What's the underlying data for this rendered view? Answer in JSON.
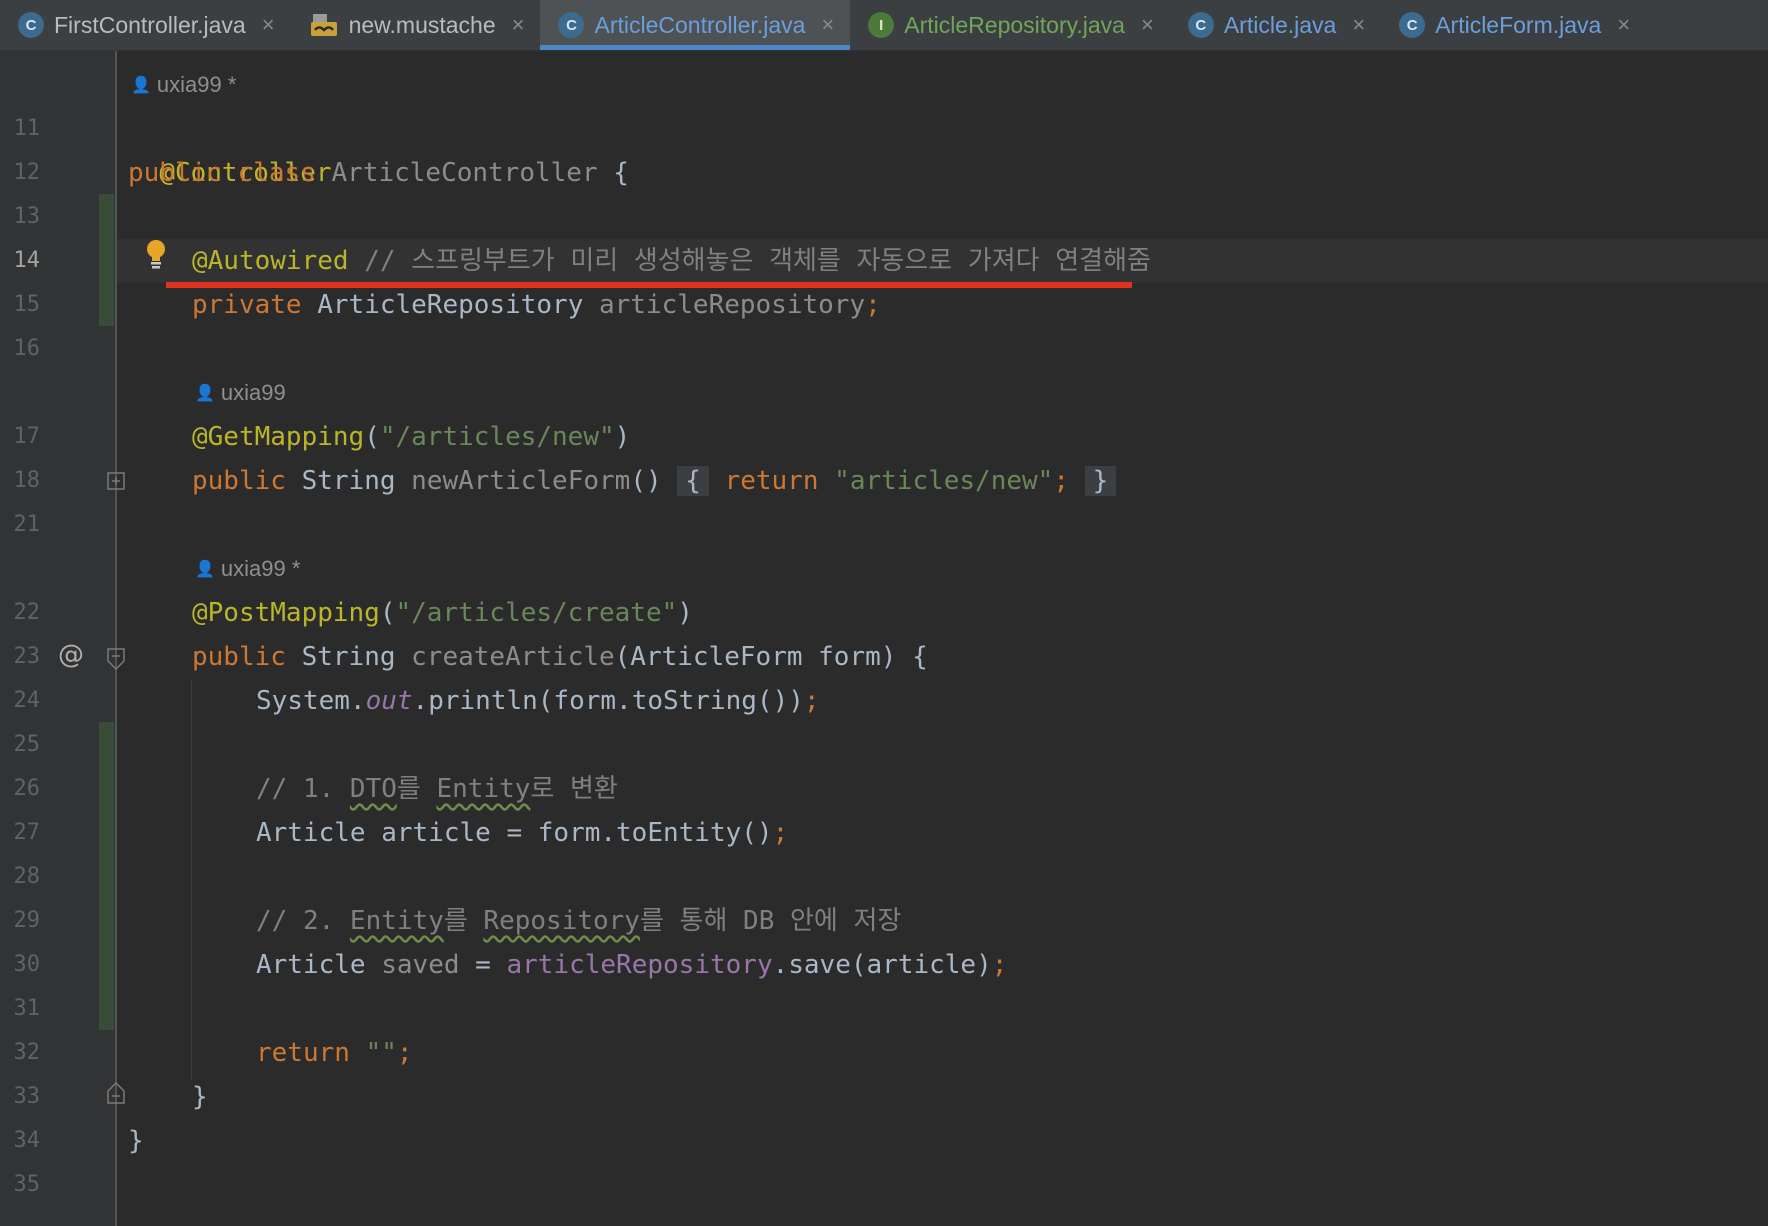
{
  "tabs": [
    {
      "label": "FirstController.java",
      "icon": "class-icon",
      "icon_glyph": "C",
      "state": "normal"
    },
    {
      "label": "new.mustache",
      "icon": "mustache-icon",
      "icon_glyph": "",
      "state": "normal"
    },
    {
      "label": "ArticleController.java",
      "icon": "class-icon",
      "icon_glyph": "C",
      "state": "active"
    },
    {
      "label": "ArticleRepository.java",
      "icon": "interface-icon",
      "icon_glyph": "I",
      "state": "green"
    },
    {
      "label": "Article.java",
      "icon": "class-icon",
      "icon_glyph": "C",
      "state": "blue"
    },
    {
      "label": "ArticleForm.java",
      "icon": "class-icon",
      "icon_glyph": "C",
      "state": "blue"
    }
  ],
  "close_glyph": "×",
  "authors": {
    "a1": "uxia99 *",
    "a2": "uxia99",
    "a3": "uxia99 *"
  },
  "line_numbers": [
    "11",
    "12",
    "13",
    "14",
    "15",
    "16",
    "17",
    "18",
    "21",
    "22",
    "23",
    "24",
    "25",
    "26",
    "27",
    "28",
    "29",
    "30",
    "31",
    "32",
    "33",
    "34",
    "35"
  ],
  "gutter_at": "@",
  "code": {
    "l11_ann": "@Controller",
    "l12_kw": "public class ",
    "l12_name": "ArticleController ",
    "l12_brace": "{",
    "l14_ann": "@Autowired",
    "l14_cmt": " // 스프링부트가 미리 생성해놓은 객체를 자동으로 가져다 연결해줌",
    "l15_kw": "private ",
    "l15_type": "ArticleRepository ",
    "l15_name": "articleRepository",
    "l15_semi": ";",
    "l17_ann": "@GetMapping",
    "l17_p1": "(",
    "l17_str": "\"/articles/new\"",
    "l17_p2": ")",
    "l18_kw": "public ",
    "l18_type": "String ",
    "l18_name": "newArticleForm",
    "l18_paren": "() ",
    "l18_ob": "{",
    "l18_ret": " return ",
    "l18_str": "\"articles/new\"",
    "l18_semi": "; ",
    "l18_cb": "}",
    "l22_ann": "@PostMapping",
    "l22_p1": "(",
    "l22_str": "\"/articles/create\"",
    "l22_p2": ")",
    "l23_kw": "public ",
    "l23_type": "String ",
    "l23_name": "createArticle",
    "l23_rest": "(ArticleForm form) {",
    "l24_a": "System.",
    "l24_out": "out",
    "l24_b": ".println(form.toString())",
    "l24_semi": ";",
    "l26_a": "// 1. ",
    "l26_dto": "DTO",
    "l26_b": "를 ",
    "l26_entity": "Entity",
    "l26_c": "로 변환",
    "l27_a": "Article article = form.toEntity()",
    "l27_semi": ";",
    "l29_a": "// 2. ",
    "l29_entity": "Entity",
    "l29_b": "를 ",
    "l29_repo": "Repository",
    "l29_c": "를 통해 DB 안에 저장",
    "l30_a": "Article ",
    "l30_saved": "saved",
    "l30_b": " = ",
    "l30_repo": "articleRepository",
    "l30_c": ".save(article)",
    "l30_semi": ";",
    "l32_kw": "return ",
    "l32_str": "\"\"",
    "l32_semi": ";",
    "l33": "}",
    "l34": "}"
  },
  "colors": {
    "background": "#2b2b2b",
    "keyword": "#cc7832",
    "annotation": "#bbb529",
    "string": "#6a8759",
    "comment": "#808080",
    "field": "#9876aa",
    "highlight_underline": "#e0301e",
    "active_tab_indicator": "#4a88c7"
  }
}
